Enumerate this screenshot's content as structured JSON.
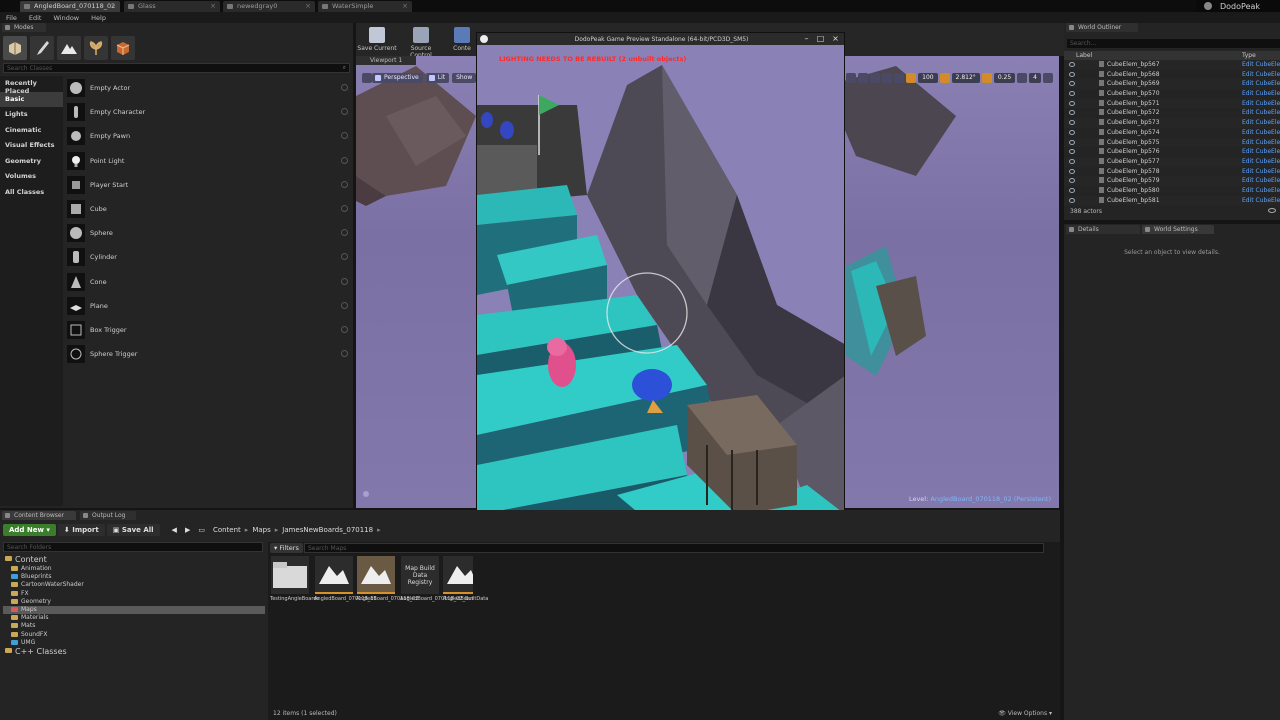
{
  "tabs": [
    {
      "label": "AngledBoard_070118_02",
      "active": true
    },
    {
      "label": "Glass",
      "active": false
    },
    {
      "label": "newedgray0",
      "active": false
    },
    {
      "label": "WaterSimple",
      "active": false
    }
  ],
  "project_name": "DodoPeak",
  "menu": [
    "File",
    "Edit",
    "Window",
    "Help"
  ],
  "modes": {
    "tab_label": "Modes",
    "search_placeholder": "Search Classes",
    "categories": [
      "Recently Placed",
      "Basic",
      "Lights",
      "Cinematic",
      "Visual Effects",
      "Geometry",
      "Volumes",
      "All Classes"
    ],
    "active_category": "Basic",
    "items": [
      "Empty Actor",
      "Empty Character",
      "Empty Pawn",
      "Point Light",
      "Player Start",
      "Cube",
      "Sphere",
      "Cylinder",
      "Cone",
      "Plane",
      "Box Trigger",
      "Sphere Trigger"
    ]
  },
  "toolbar": {
    "save_current": "Save Current",
    "source_control": "Source Control",
    "content": "Conte"
  },
  "viewport": {
    "tab_label": "Viewport 1",
    "perspective": "Perspective",
    "lit": "Lit",
    "show": "Show",
    "grid_value": "100",
    "angle_value": "2.812°",
    "scale_value": "0.25",
    "cam_value": "4",
    "level_prefix": "Level:",
    "level_name": "AngledBoard_070118_02 (Persistent)"
  },
  "game_preview": {
    "title": "DodoPeak Game Preview Standalone (64-bit/PCD3D_SM5)",
    "warning": "LIGHTING NEEDS TO BE REBUILT (2 unbuilt objects)"
  },
  "outliner": {
    "tab_label": "World Outliner",
    "search_placeholder": "Search...",
    "col_label": "Label",
    "col_type": "Type",
    "rows": [
      {
        "name": "CubeElem_bp567",
        "type": "Edit CubeEle"
      },
      {
        "name": "CubeElem_bp568",
        "type": "Edit CubeEle"
      },
      {
        "name": "CubeElem_bp569",
        "type": "Edit CubeEle"
      },
      {
        "name": "CubeElem_bp570",
        "type": "Edit CubeEle"
      },
      {
        "name": "CubeElem_bp571",
        "type": "Edit CubeEle"
      },
      {
        "name": "CubeElem_bp572",
        "type": "Edit CubeEle"
      },
      {
        "name": "CubeElem_bp573",
        "type": "Edit CubeEle"
      },
      {
        "name": "CubeElem_bp574",
        "type": "Edit CubeEle"
      },
      {
        "name": "CubeElem_bp575",
        "type": "Edit CubeEle"
      },
      {
        "name": "CubeElem_bp576",
        "type": "Edit CubeEle"
      },
      {
        "name": "CubeElem_bp577",
        "type": "Edit CubeEle"
      },
      {
        "name": "CubeElem_bp578",
        "type": "Edit CubeEle"
      },
      {
        "name": "CubeElem_bp579",
        "type": "Edit CubeEle"
      },
      {
        "name": "CubeElem_bp580",
        "type": "Edit CubeEle"
      },
      {
        "name": "CubeElem_bp581",
        "type": "Edit CubeEle"
      }
    ],
    "actor_count": "388 actors"
  },
  "details": {
    "tab_details": "Details",
    "tab_world_settings": "World Settings",
    "empty_message": "Select an object to view details."
  },
  "content_browser": {
    "tab_label": "Content Browser",
    "output_log_tab": "Output Log",
    "add_new": "Add New",
    "import": "Import",
    "save_all": "Save All",
    "breadcrumb": [
      "Content",
      "Maps",
      "JamesNewBoards_070118"
    ],
    "folder_search_placeholder": "Search Folders",
    "filters": "Filters",
    "assets_search_placeholder": "Search Maps",
    "tree": [
      {
        "label": "Content",
        "depth": 0,
        "root": true
      },
      {
        "label": "Animation",
        "depth": 1
      },
      {
        "label": "Blueprints",
        "depth": 1
      },
      {
        "label": "CartoonWaterShader",
        "depth": 1
      },
      {
        "label": "FX",
        "depth": 1
      },
      {
        "label": "Geometry",
        "depth": 1
      },
      {
        "label": "Maps",
        "depth": 1,
        "selected": true
      },
      {
        "label": "Materials",
        "depth": 1
      },
      {
        "label": "Mats",
        "depth": 1
      },
      {
        "label": "SoundFX",
        "depth": 1
      },
      {
        "label": "UMG",
        "depth": 1
      },
      {
        "label": "C++ Classes",
        "depth": 0,
        "root": true
      }
    ],
    "assets": [
      {
        "label": "TestingAngleBoards",
        "kind": "folder"
      },
      {
        "label": "AngledBoard_070118_11",
        "kind": "map"
      },
      {
        "label": "AngledBoard_070118_02",
        "kind": "map",
        "selected": true
      },
      {
        "label": "AngledBoard_070118_02_BuiltData",
        "kind": "data",
        "thumb_text": "Map Build Data Registry"
      },
      {
        "label": "AngledBoard_070118_0",
        "kind": "map"
      }
    ],
    "status": "12 items (1 selected)",
    "view_options": "View Options"
  }
}
